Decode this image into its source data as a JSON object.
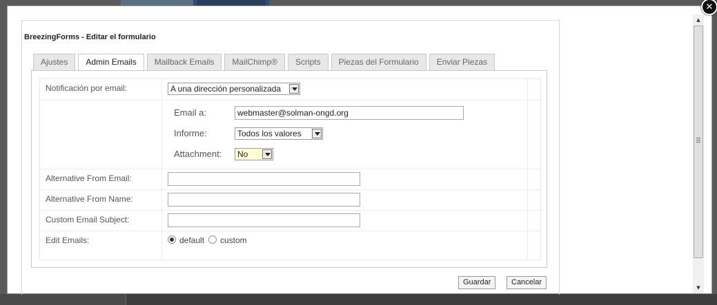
{
  "window": {
    "title": "BreezingForms - Editar el formulario",
    "close_icon": "close-icon"
  },
  "tabs": [
    {
      "label": "Ajustes",
      "active": false
    },
    {
      "label": "Admin Emails",
      "active": true
    },
    {
      "label": "Mailback Emails",
      "active": false
    },
    {
      "label": "MailChimp®",
      "active": false
    },
    {
      "label": "Scripts",
      "active": false
    },
    {
      "label": "Piezas del Formulario",
      "active": false
    },
    {
      "label": "Enviar Piezas",
      "active": false
    }
  ],
  "form": {
    "notification": {
      "label": "Notificación por email:",
      "value": "A una dirección personalizada"
    },
    "email_to": {
      "label": "Email a:",
      "value": "webmaster@solman-ongd.org"
    },
    "report": {
      "label": "Informe:",
      "value": "Todos los valores"
    },
    "attachment": {
      "label": "Attachment:",
      "value": "No"
    },
    "alt_from_email": {
      "label": "Alternative From Email:",
      "value": ""
    },
    "alt_from_name": {
      "label": "Alternative From Name:",
      "value": ""
    },
    "custom_subject": {
      "label": "Custom Email Subject:",
      "value": ""
    },
    "edit_emails": {
      "label": "Edit Emails:",
      "options": [
        "default",
        "custom"
      ],
      "selected": "default"
    }
  },
  "buttons": {
    "save": "Guardar",
    "cancel": "Cancelar"
  }
}
